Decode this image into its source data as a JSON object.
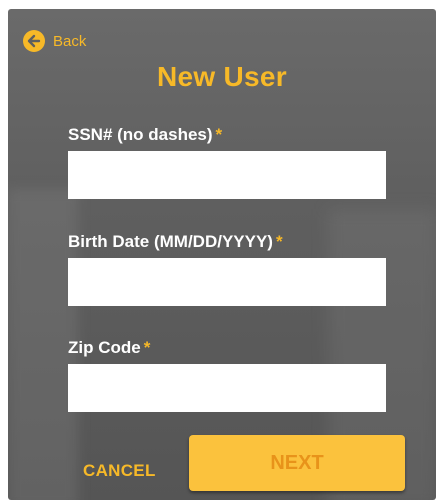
{
  "back": {
    "label": "Back",
    "icon": "arrow-left-icon"
  },
  "title": "New User",
  "required_marker": "*",
  "fields": [
    {
      "label": "SSN# (no dashes)",
      "value": "",
      "required": true
    },
    {
      "label": "Birth Date (MM/DD/YYYY)",
      "value": "",
      "required": true
    },
    {
      "label": "Zip Code",
      "value": "",
      "required": true
    }
  ],
  "actions": {
    "cancel_label": "CANCEL",
    "next_label": "NEXT"
  },
  "colors": {
    "accent": "#f7b928",
    "panel": "#5f5f5f",
    "next_text": "#e8931a"
  }
}
